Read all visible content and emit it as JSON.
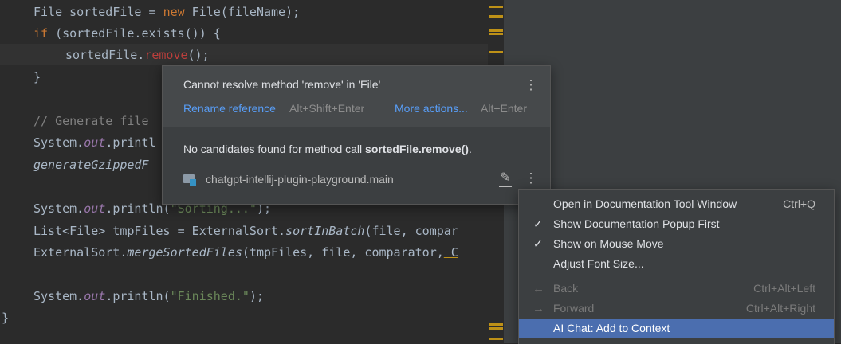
{
  "editor": {
    "lines": {
      "l1": {
        "a": "File sortedFile = ",
        "kw": "new",
        "b": " File(fileName);"
      },
      "l2": {
        "kw": "if",
        "a": " (sortedFile.exists()) {"
      },
      "l3": {
        "a": "sortedFile.",
        "err": "remove",
        "b": "();"
      },
      "l4": {
        "a": "}"
      },
      "l5": {
        "cm": "// Generate file"
      },
      "l6": {
        "a": "System.",
        "fld": "out",
        "b": ".printl"
      },
      "l7": {
        "it": "generateGzippedF"
      },
      "l8": {
        "a": "System.",
        "fld": "out",
        "b": ".println(",
        "str": "\"Sorting...\"",
        "c": ");"
      },
      "l9": {
        "a": "List<File> tmpFiles = ExternalSort.",
        "it": "sortInBatch",
        "b": "(file, compar"
      },
      "l10": {
        "a": "ExternalSort.",
        "it": "mergeSortedFiles",
        "b": "(tmpFiles, file, comparator,",
        "c": " C"
      },
      "l11": {
        "a": "System.",
        "fld": "out",
        "b": ".println(",
        "str": "\"Finished.\"",
        "c": ");"
      },
      "l12": {
        "a": "}"
      }
    }
  },
  "popup": {
    "message": "Cannot resolve method 'remove' in 'File'",
    "rename_label": "Rename reference",
    "rename_shortcut": "Alt+Shift+Enter",
    "more_label": "More actions...",
    "more_shortcut": "Alt+Enter",
    "body_prefix": "No candidates found for method call ",
    "body_bold": "sortedFile.remove()",
    "body_suffix": ".",
    "module": "chatgpt-intellij-plugin-playground.main",
    "icons": {
      "kebab": "⋮",
      "edit": "✎"
    }
  },
  "menu": {
    "items": [
      {
        "label": "Open in Documentation Tool Window",
        "shortcut": "Ctrl+Q"
      },
      {
        "label": "Show Documentation Popup First",
        "checked": "✓"
      },
      {
        "label": "Show on Mouse Move",
        "checked": "✓"
      },
      {
        "label": "Adjust Font Size..."
      },
      {
        "label": "Back",
        "shortcut": "Ctrl+Alt+Left",
        "arrow": "←"
      },
      {
        "label": "Forward",
        "shortcut": "Ctrl+Alt+Right",
        "arrow": "→"
      },
      {
        "label": "AI Chat: Add to Context"
      }
    ]
  },
  "colors": {
    "accent": "#589df6",
    "selection": "#4b6eaf",
    "warning_mark": "#be9117",
    "error_text": "#bc3f3c"
  }
}
